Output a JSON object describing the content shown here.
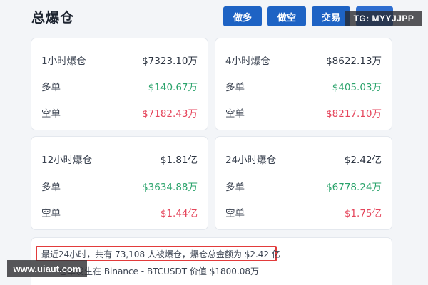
{
  "header": {
    "title": "总爆仓",
    "buttons": {
      "long": "做多",
      "short": "做空",
      "trade": "交易",
      "extra": ""
    }
  },
  "watermarks": {
    "telegram": "TG: MYYJJPP",
    "url": "www.uiaut.com"
  },
  "cards": [
    {
      "period_label": "1小时爆仓",
      "total": "$7323.10万",
      "long_label": "多单",
      "long_value": "$140.67万",
      "short_label": "空单",
      "short_value": "$7182.43万"
    },
    {
      "period_label": "4小时爆仓",
      "total": "$8622.13万",
      "long_label": "多单",
      "long_value": "$405.03万",
      "short_label": "空单",
      "short_value": "$8217.10万"
    },
    {
      "period_label": "12小时爆仓",
      "total": "$1.81亿",
      "long_label": "多单",
      "long_value": "$3634.88万",
      "short_label": "空单",
      "short_value": "$1.44亿"
    },
    {
      "period_label": "24小时爆仓",
      "total": "$2.42亿",
      "long_label": "多单",
      "long_value": "$6778.24万",
      "short_label": "空单",
      "short_value": "$1.75亿"
    }
  ],
  "summary": {
    "line1": "最近24小时，共有 73,108 人被爆仓，爆仓总金额为 $2.42 亿",
    "line2": "仓单发生在 Binance - BTCUSDT 价值 $1800.08万"
  },
  "colors": {
    "button_blue": "#1e63c4",
    "long_green": "#2aa36b",
    "short_red": "#e5465c",
    "highlight_red": "#e23b3b"
  }
}
